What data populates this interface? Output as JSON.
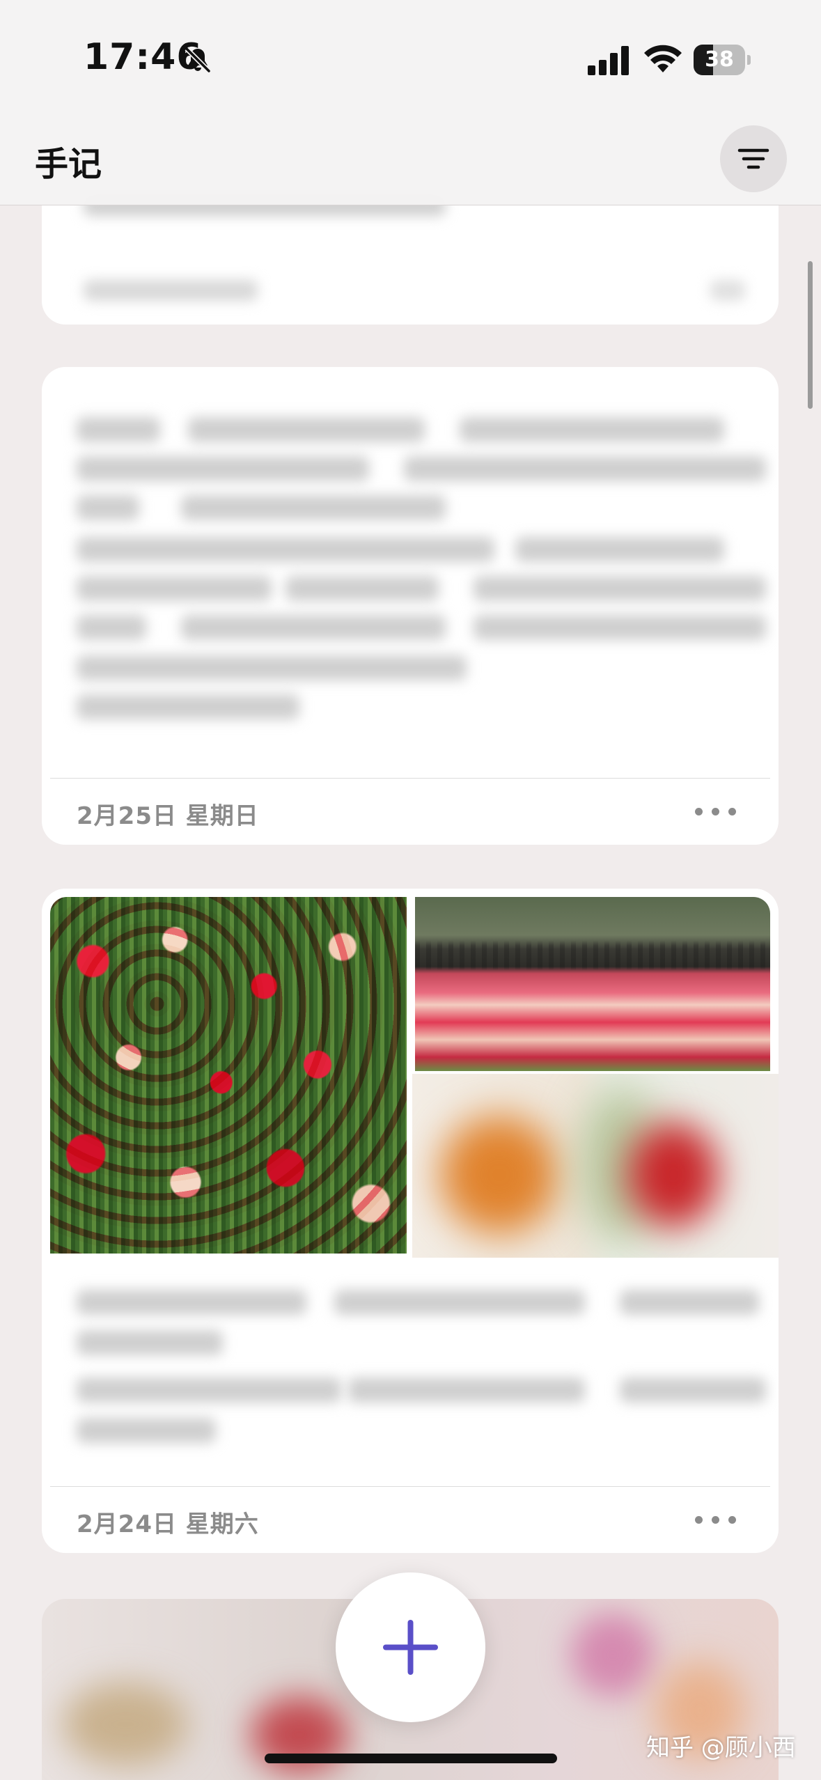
{
  "status_bar": {
    "time": "17:46",
    "battery_level": "38",
    "battery_fraction": 0.38
  },
  "nav": {
    "title": "手记",
    "filter_icon": "filter-lines-icon"
  },
  "entries": [
    {
      "kind": "text-note",
      "date": "2月25日 星期日",
      "more_icon": "ellipsis-icon"
    },
    {
      "kind": "photo-note",
      "date": "2月24日 星期六",
      "more_icon": "ellipsis-icon"
    }
  ],
  "fab": {
    "icon": "plus-icon",
    "color": "#5a4fc8"
  },
  "watermark": "知乎 @顾小西"
}
